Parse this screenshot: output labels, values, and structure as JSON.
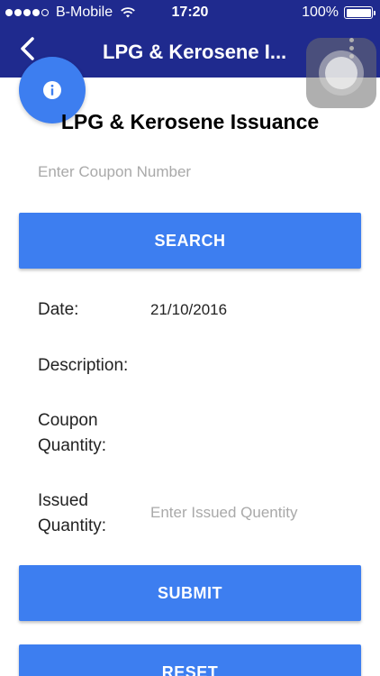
{
  "status_bar": {
    "carrier": "B-Mobile",
    "time": "17:20",
    "battery": "100%",
    "battery_level": 1.0,
    "signal_bars_filled": 4,
    "signal_bars_total": 5
  },
  "app_bar": {
    "title": "LPG & Kerosene I...",
    "color": "#1f2a8e"
  },
  "page": {
    "title": "LPG & Kerosene Issuance"
  },
  "coupon": {
    "placeholder": "Enter Coupon Number",
    "value": ""
  },
  "buttons": {
    "search": "SEARCH",
    "submit": "SUBMIT",
    "reset": "RESET",
    "color": "#3d7ef0"
  },
  "fields": {
    "date_label": "Date:",
    "date_value": "21/10/2016",
    "description_label": "Description:",
    "coupon_quantity_label_line1": "Coupon",
    "coupon_quantity_label_line2": "Quantity:",
    "issued_quantity_label_line1": "Issued",
    "issued_quantity_label_line2": "Quantity:",
    "issued_quantity_placeholder": "Enter Issued Quentity",
    "issued_quantity_value": ""
  },
  "icons": {
    "back": "chevron-left-icon",
    "menu": "more-vertical-icon",
    "info": "info-icon",
    "wifi": "wifi-icon",
    "battery": "battery-icon",
    "assistive_touch": "assistive-touch-icon"
  }
}
